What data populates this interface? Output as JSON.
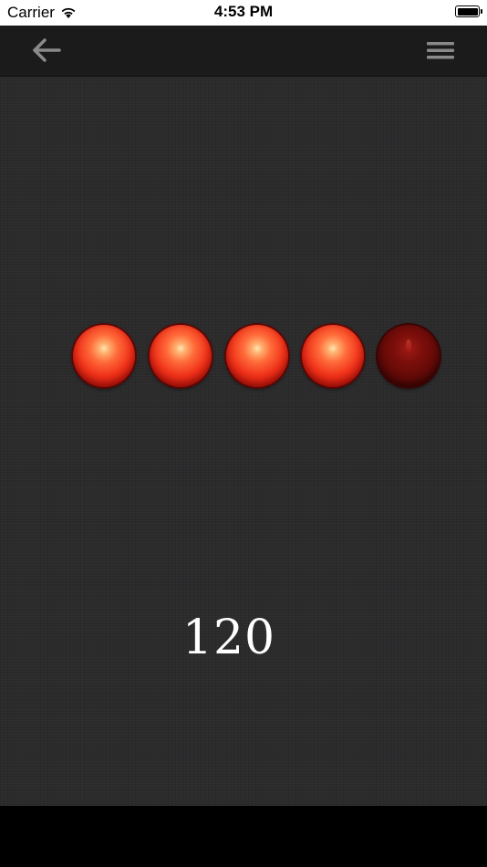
{
  "status_bar": {
    "carrier": "Carrier",
    "time": "4:53 PM",
    "battery_level": 1.0
  },
  "nav_bar": {
    "back_icon": "arrow-left-icon",
    "menu_icon": "hamburger-menu-icon",
    "icon_color": "#8a8a8a"
  },
  "lights": {
    "states": [
      "on",
      "on",
      "on",
      "on",
      "off"
    ],
    "lit_count": 4,
    "total": 5,
    "on_color": "#f0321a",
    "off_color": "#5e0907"
  },
  "counter": {
    "value": "120"
  }
}
